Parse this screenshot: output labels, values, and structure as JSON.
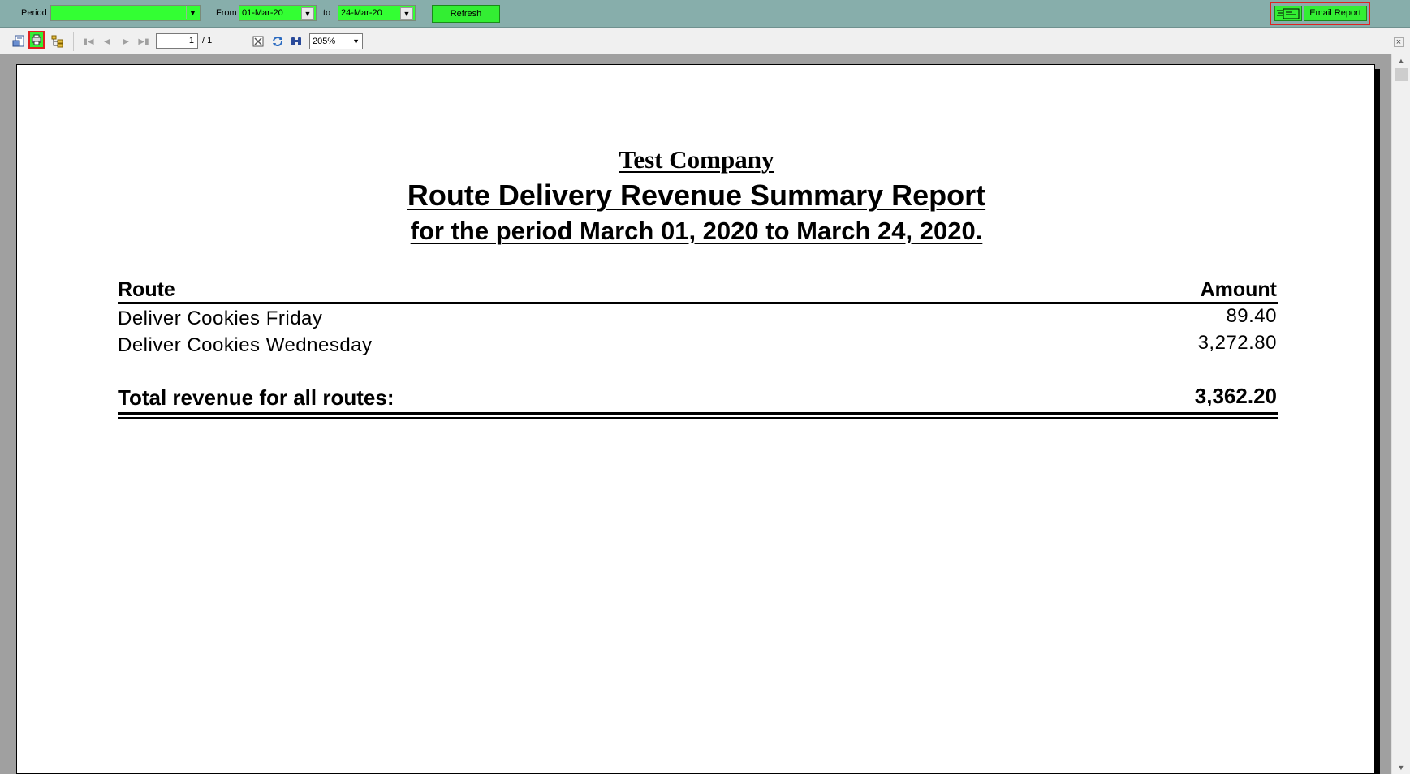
{
  "filters": {
    "period_label": "Period",
    "period_value": "",
    "from_label": "From",
    "from_value": "01-Mar-20",
    "to_label": "to",
    "to_value": "24-Mar-20",
    "refresh_label": "Refresh",
    "email_label": "Email Report"
  },
  "toolbar": {
    "page_current": "1",
    "page_total": "/ 1",
    "zoom": "205%"
  },
  "report": {
    "company": "Test Company",
    "title": "Route Delivery Revenue Summary Report",
    "period": "for the period March 01, 2020 to March 24, 2020.",
    "col_route": "Route",
    "col_amount": "Amount",
    "rows": [
      {
        "route": "Deliver Cookies Friday",
        "amount": "89.40"
      },
      {
        "route": "Deliver Cookies Wednesday",
        "amount": "3,272.80"
      }
    ],
    "total_label": "Total revenue for all routes:",
    "total_amount": "3,362.20"
  },
  "colors": {
    "topbar": "#87aeab",
    "field_green": "#33ff33",
    "highlight_red": "#e02020"
  }
}
